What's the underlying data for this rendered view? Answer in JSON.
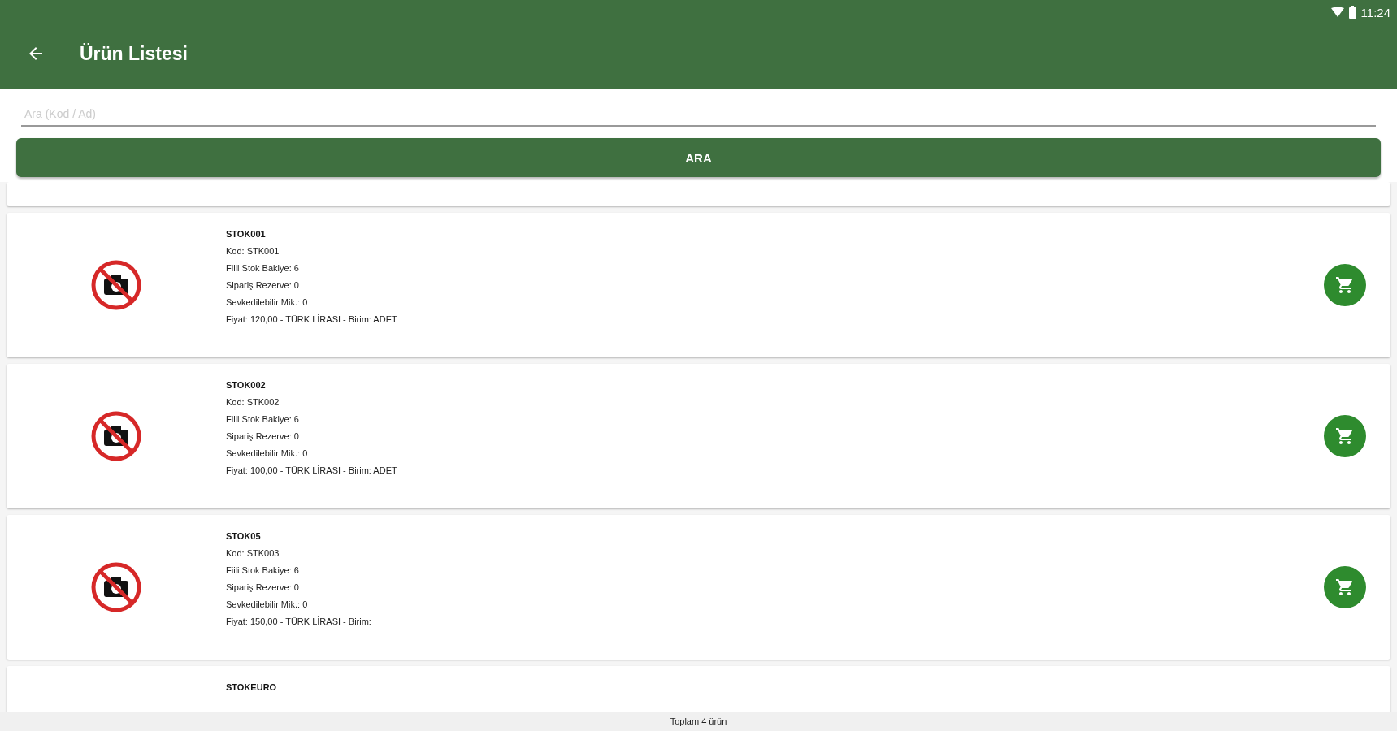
{
  "status_bar": {
    "time": "11:24"
  },
  "app_bar": {
    "title": "Ürün Listesi"
  },
  "search": {
    "placeholder": "Ara (Kod / Ad)",
    "button": "ARA"
  },
  "products": [
    {
      "name": "STOK001",
      "lines": [
        "Kod: STK001",
        "Fiili Stok Bakiye: 6",
        "Sipariş Rezerve: 0",
        "Sevkedilebilir Mik.: 0",
        "Fiyat: 120,00 - TÜRK LİRASI - Birim: ADET"
      ]
    },
    {
      "name": "STOK002",
      "lines": [
        "Kod: STK002",
        "Fiili Stok Bakiye: 6",
        "Sipariş Rezerve: 0",
        "Sevkedilebilir Mik.: 0",
        "Fiyat: 100,00 - TÜRK LİRASI - Birim: ADET"
      ]
    },
    {
      "name": "STOK05",
      "lines": [
        "Kod: STK003",
        "Fiili Stok Bakiye: 6",
        "Sipariş Rezerve: 0",
        "Sevkedilebilir Mik.: 0",
        "Fiyat: 150,00 - TÜRK LİRASI - Birim:"
      ]
    },
    {
      "name": "STOKEURO"
    }
  ],
  "footer": {
    "total": "Toplam 4 ürün"
  }
}
